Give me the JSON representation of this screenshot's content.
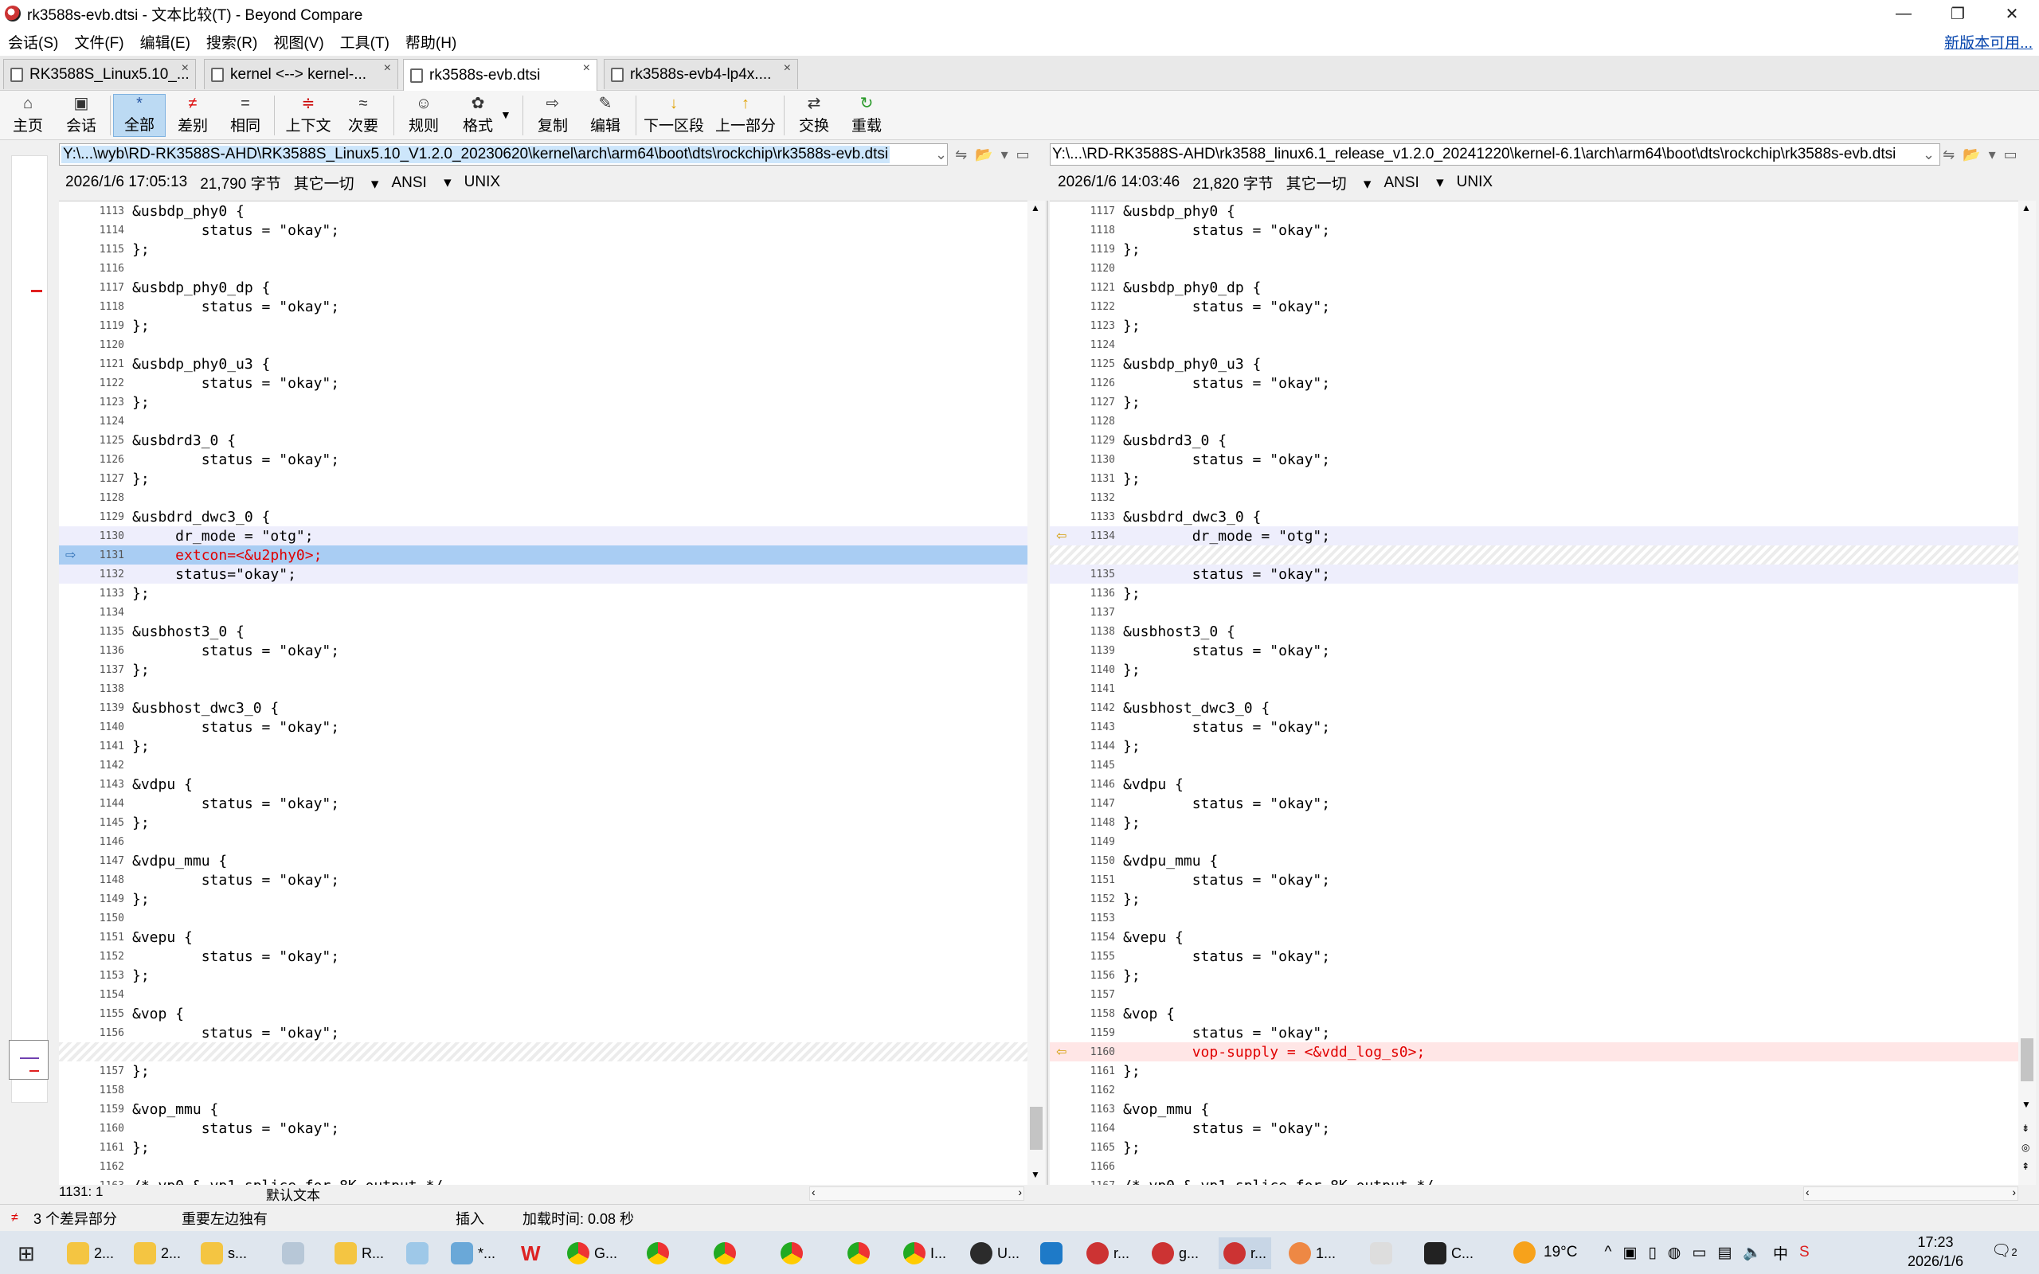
{
  "window": {
    "title": "rk3588s-evb.dtsi - 文本比较(T) - Beyond Compare",
    "minimize": "—",
    "restore": "❐",
    "close": "✕"
  },
  "menu": {
    "items": [
      "会话(S)",
      "文件(F)",
      "编辑(E)",
      "搜索(R)",
      "视图(V)",
      "工具(T)",
      "帮助(H)"
    ],
    "new_version": "新版本可用..."
  },
  "tabs": [
    {
      "label": "RK3588S_Linux5.10_...",
      "close": "×"
    },
    {
      "label": "kernel <--> kernel-...",
      "close": "×"
    },
    {
      "label": "rk3588s-evb.dtsi",
      "close": "×"
    },
    {
      "label": "rk3588s-evb4-lp4x....",
      "close": "×"
    }
  ],
  "toolbar": [
    {
      "label": "主页",
      "icon": "⌂"
    },
    {
      "label": "会话",
      "icon": "▣"
    },
    {
      "label": "全部",
      "icon": "*"
    },
    {
      "label": "差别",
      "icon": "≠"
    },
    {
      "label": "相同",
      "icon": "="
    },
    {
      "label": "上下文",
      "icon": "≑"
    },
    {
      "label": "次要",
      "icon": "≈"
    },
    {
      "label": "规则",
      "icon": "☺"
    },
    {
      "label": "格式",
      "icon": "✿"
    },
    {
      "label": "复制",
      "icon": "⇨"
    },
    {
      "label": "编辑",
      "icon": "✎"
    },
    {
      "label": "下一区段",
      "icon": "↓"
    },
    {
      "label": "上一部分",
      "icon": "↑"
    },
    {
      "label": "交换",
      "icon": "⇄"
    },
    {
      "label": "重载",
      "icon": "↻"
    }
  ],
  "left": {
    "path": "Y:\\...\\wyb\\RD-RK3588S-AHD\\RK3588S_Linux5.10_V1.2.0_20230620\\kernel\\arch\\arm64\\boot\\dts\\rockchip\\rk3588s-evb.dtsi",
    "date": "2026/1/6 17:05:13",
    "size": "21,790 字节",
    "other": "其它一切",
    "encoding": "ANSI",
    "eol": "UNIX",
    "cursor": "1131: 1",
    "mode": "默认文本"
  },
  "right": {
    "path": "Y:\\...\\RD-RK3588S-AHD\\rk3588_linux6.1_release_v1.2.0_20241220\\kernel-6.1\\arch\\arm64\\boot\\dts\\rockchip\\rk3588s-evb.dtsi",
    "date": "2026/1/6 14:03:46",
    "size": "21,820 字节",
    "other": "其它一切",
    "encoding": "ANSI",
    "eol": "UNIX"
  },
  "left_lines": [
    {
      "n": "1113",
      "t": "&usbdp_phy0 {"
    },
    {
      "n": "1114",
      "t": "        status = \"okay\";"
    },
    {
      "n": "1115",
      "t": "};"
    },
    {
      "n": "1116",
      "t": ""
    },
    {
      "n": "1117",
      "t": "&usbdp_phy0_dp {"
    },
    {
      "n": "1118",
      "t": "        status = \"okay\";"
    },
    {
      "n": "1119",
      "t": "};"
    },
    {
      "n": "1120",
      "t": ""
    },
    {
      "n": "1121",
      "t": "&usbdp_phy0_u3 {"
    },
    {
      "n": "1122",
      "t": "        status = \"okay\";"
    },
    {
      "n": "1123",
      "t": "};"
    },
    {
      "n": "1124",
      "t": ""
    },
    {
      "n": "1125",
      "t": "&usbdrd3_0 {"
    },
    {
      "n": "1126",
      "t": "        status = \"okay\";"
    },
    {
      "n": "1127",
      "t": "};"
    },
    {
      "n": "1128",
      "t": ""
    },
    {
      "n": "1129",
      "t": "&usbdrd_dwc3_0 {"
    },
    {
      "n": "1130",
      "t": "     dr_mode = \"otg\";",
      "k": "ctx"
    },
    {
      "n": "1131",
      "t": "     extcon=<&u2phy0>;",
      "k": "sel"
    },
    {
      "n": "1132",
      "t": "     status=\"okay\";",
      "k": "ctx"
    },
    {
      "n": "1133",
      "t": "};"
    },
    {
      "n": "1134",
      "t": ""
    },
    {
      "n": "1135",
      "t": "&usbhost3_0 {"
    },
    {
      "n": "1136",
      "t": "        status = \"okay\";"
    },
    {
      "n": "1137",
      "t": "};"
    },
    {
      "n": "1138",
      "t": ""
    },
    {
      "n": "1139",
      "t": "&usbhost_dwc3_0 {"
    },
    {
      "n": "1140",
      "t": "        status = \"okay\";"
    },
    {
      "n": "1141",
      "t": "};"
    },
    {
      "n": "1142",
      "t": ""
    },
    {
      "n": "1143",
      "t": "&vdpu {"
    },
    {
      "n": "1144",
      "t": "        status = \"okay\";"
    },
    {
      "n": "1145",
      "t": "};"
    },
    {
      "n": "1146",
      "t": ""
    },
    {
      "n": "1147",
      "t": "&vdpu_mmu {"
    },
    {
      "n": "1148",
      "t": "        status = \"okay\";"
    },
    {
      "n": "1149",
      "t": "};"
    },
    {
      "n": "1150",
      "t": ""
    },
    {
      "n": "1151",
      "t": "&vepu {"
    },
    {
      "n": "1152",
      "t": "        status = \"okay\";"
    },
    {
      "n": "1153",
      "t": "};"
    },
    {
      "n": "1154",
      "t": ""
    },
    {
      "n": "1155",
      "t": "&vop {"
    },
    {
      "n": "1156",
      "t": "        status = \"okay\";"
    },
    {
      "n": "",
      "t": "",
      "k": "hatch"
    },
    {
      "n": "1157",
      "t": "};"
    },
    {
      "n": "1158",
      "t": ""
    },
    {
      "n": "1159",
      "t": "&vop_mmu {"
    },
    {
      "n": "1160",
      "t": "        status = \"okay\";"
    },
    {
      "n": "1161",
      "t": "};"
    },
    {
      "n": "1162",
      "t": ""
    },
    {
      "n": "1163",
      "t": "/* vp0 & vp1 splice for 8K output */"
    }
  ],
  "right_lines": [
    {
      "n": "1117",
      "t": "&usbdp_phy0 {"
    },
    {
      "n": "1118",
      "t": "        status = \"okay\";"
    },
    {
      "n": "1119",
      "t": "};"
    },
    {
      "n": "1120",
      "t": ""
    },
    {
      "n": "1121",
      "t": "&usbdp_phy0_dp {"
    },
    {
      "n": "1122",
      "t": "        status = \"okay\";"
    },
    {
      "n": "1123",
      "t": "};"
    },
    {
      "n": "1124",
      "t": ""
    },
    {
      "n": "1125",
      "t": "&usbdp_phy0_u3 {"
    },
    {
      "n": "1126",
      "t": "        status = \"okay\";"
    },
    {
      "n": "1127",
      "t": "};"
    },
    {
      "n": "1128",
      "t": ""
    },
    {
      "n": "1129",
      "t": "&usbdrd3_0 {"
    },
    {
      "n": "1130",
      "t": "        status = \"okay\";"
    },
    {
      "n": "1131",
      "t": "};"
    },
    {
      "n": "1132",
      "t": ""
    },
    {
      "n": "1133",
      "t": "&usbdrd_dwc3_0 {"
    },
    {
      "n": "1134",
      "t": "        dr_mode = \"otg\";",
      "k": "ctx",
      "a": true
    },
    {
      "n": "",
      "t": "",
      "k": "hatch"
    },
    {
      "n": "1135",
      "t": "        status = \"okay\";",
      "k": "ctx"
    },
    {
      "n": "1136",
      "t": "};"
    },
    {
      "n": "1137",
      "t": ""
    },
    {
      "n": "1138",
      "t": "&usbhost3_0 {"
    },
    {
      "n": "1139",
      "t": "        status = \"okay\";"
    },
    {
      "n": "1140",
      "t": "};"
    },
    {
      "n": "1141",
      "t": ""
    },
    {
      "n": "1142",
      "t": "&usbhost_dwc3_0 {"
    },
    {
      "n": "1143",
      "t": "        status = \"okay\";"
    },
    {
      "n": "1144",
      "t": "};"
    },
    {
      "n": "1145",
      "t": ""
    },
    {
      "n": "1146",
      "t": "&vdpu {"
    },
    {
      "n": "1147",
      "t": "        status = \"okay\";"
    },
    {
      "n": "1148",
      "t": "};"
    },
    {
      "n": "1149",
      "t": ""
    },
    {
      "n": "1150",
      "t": "&vdpu_mmu {"
    },
    {
      "n": "1151",
      "t": "        status = \"okay\";"
    },
    {
      "n": "1152",
      "t": "};"
    },
    {
      "n": "1153",
      "t": ""
    },
    {
      "n": "1154",
      "t": "&vepu {"
    },
    {
      "n": "1155",
      "t": "        status = \"okay\";"
    },
    {
      "n": "1156",
      "t": "};"
    },
    {
      "n": "1157",
      "t": ""
    },
    {
      "n": "1158",
      "t": "&vop {"
    },
    {
      "n": "1159",
      "t": "        status = \"okay\";"
    },
    {
      "n": "1160",
      "t": "        vop-supply = <&vdd_log_s0>;",
      "k": "red",
      "a": true
    },
    {
      "n": "1161",
      "t": "};"
    },
    {
      "n": "1162",
      "t": ""
    },
    {
      "n": "1163",
      "t": "&vop_mmu {"
    },
    {
      "n": "1164",
      "t": "        status = \"okay\";"
    },
    {
      "n": "1165",
      "t": "};"
    },
    {
      "n": "1166",
      "t": ""
    },
    {
      "n": "1167",
      "t": "/* vp0 & vp1 splice for 8K output */"
    }
  ],
  "statusbar": {
    "diffs": "3 个差异部分",
    "important": "重要左边独有",
    "insert": "插入",
    "load_time": "加载时间: 0.08 秒"
  },
  "taskbar": {
    "items": [
      "2...",
      "2...",
      "s...",
      "R...",
      "*...",
      "G...",
      "I...",
      "U...",
      "r...",
      "g...",
      "r...",
      "1...",
      "C..."
    ],
    "weather": "19°C",
    "time": "17:23",
    "date": "2026/1/6",
    "notifications": "2",
    "ime": "中"
  }
}
